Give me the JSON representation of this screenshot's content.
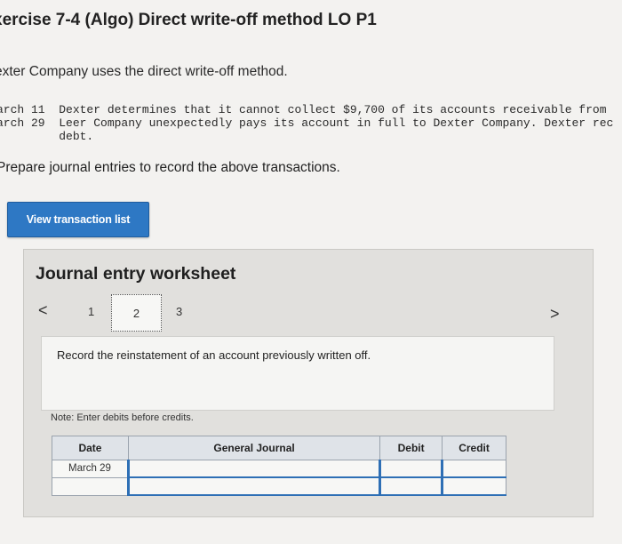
{
  "header": {
    "title": "xercise 7-4 (Algo) Direct write-off method LO P1"
  },
  "problem": {
    "intro": "exter Company uses the direct write-off method.",
    "lines": [
      "arch 11  Dexter determines that it cannot collect $9,700 of its accounts receivable from",
      "arch 29  Leer Company unexpectedly pays its account in full to Dexter Company. Dexter rec",
      "         debt."
    ],
    "instruction": "Prepare journal entries to record the above transactions."
  },
  "toolbar": {
    "view_transactions_label": "View transaction list"
  },
  "worksheet": {
    "title": "Journal entry worksheet",
    "nav_prev": "<",
    "nav_next": ">",
    "pages": [
      "1",
      "2",
      "3"
    ],
    "current_page": "2",
    "description": "Record the reinstatement of an account previously written off.",
    "note": "Note: Enter debits before credits.",
    "table": {
      "headers": [
        "Date",
        "General Journal",
        "Debit",
        "Credit"
      ],
      "rows": [
        {
          "date": "March 29",
          "account": "",
          "debit": "",
          "credit": ""
        },
        {
          "date": "",
          "account": "",
          "debit": "",
          "credit": ""
        }
      ]
    }
  }
}
